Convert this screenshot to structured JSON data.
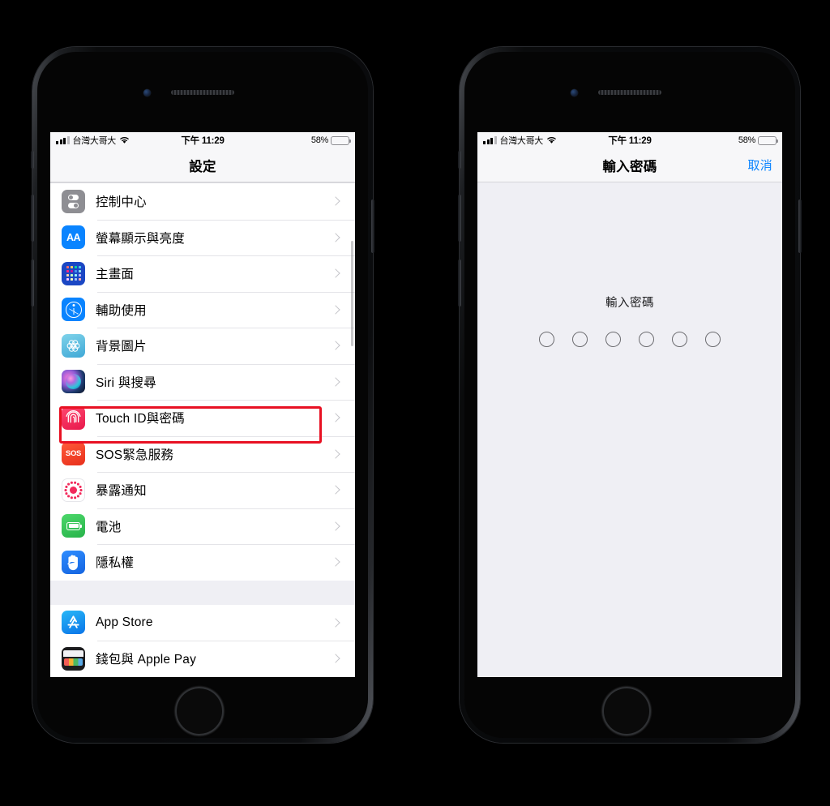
{
  "background_color": "#000000",
  "accent_color": "#0a84ff",
  "highlight_color": "#e81123",
  "status_bar": {
    "carrier": "台灣大哥大",
    "wifi_icon": "wifi-icon",
    "signal_icon": "cellular-signal-icon",
    "time": "下午 11:29",
    "battery_percent": "58%",
    "battery_level": 58,
    "battery_icon": "battery-icon"
  },
  "phone_left": {
    "nav": {
      "title": "設定"
    },
    "groups": [
      {
        "rows": [
          {
            "label": "控制中心",
            "icon": "control-center-icon",
            "icon_class": "ic-control"
          },
          {
            "label": "螢幕顯示與亮度",
            "icon": "display-brightness-icon",
            "icon_class": "ic-aa"
          },
          {
            "label": "主畫面",
            "icon": "home-screen-icon",
            "icon_class": "ic-home"
          },
          {
            "label": "輔助使用",
            "icon": "accessibility-icon",
            "icon_class": "ic-access"
          },
          {
            "label": "背景圖片",
            "icon": "wallpaper-icon",
            "icon_class": "ic-wall"
          },
          {
            "label": "Siri 與搜尋",
            "icon": "siri-icon",
            "icon_class": "ic-siri"
          },
          {
            "label": "Touch ID與密碼",
            "icon": "touch-id-icon",
            "icon_class": "ic-touch",
            "highlighted": true
          },
          {
            "label": "SOS緊急服務",
            "icon": "emergency-sos-icon",
            "icon_class": "ic-sos"
          },
          {
            "label": "暴露通知",
            "icon": "exposure-notification-icon",
            "icon_class": "ic-expose"
          },
          {
            "label": "電池",
            "icon": "battery-settings-icon",
            "icon_class": "ic-batt"
          },
          {
            "label": "隱私權",
            "icon": "privacy-icon",
            "icon_class": "ic-priv"
          }
        ]
      },
      {
        "rows": [
          {
            "label": "App Store",
            "icon": "app-store-icon",
            "icon_class": "ic-appstore"
          },
          {
            "label": "錢包與 Apple Pay",
            "icon": "wallet-icon",
            "icon_class": "ic-wallet"
          }
        ]
      }
    ]
  },
  "phone_right": {
    "nav": {
      "title": "輸入密碼",
      "action_label": "取消"
    },
    "passcode": {
      "prompt": "輸入密碼",
      "digit_count": 6,
      "entered_count": 0
    }
  }
}
